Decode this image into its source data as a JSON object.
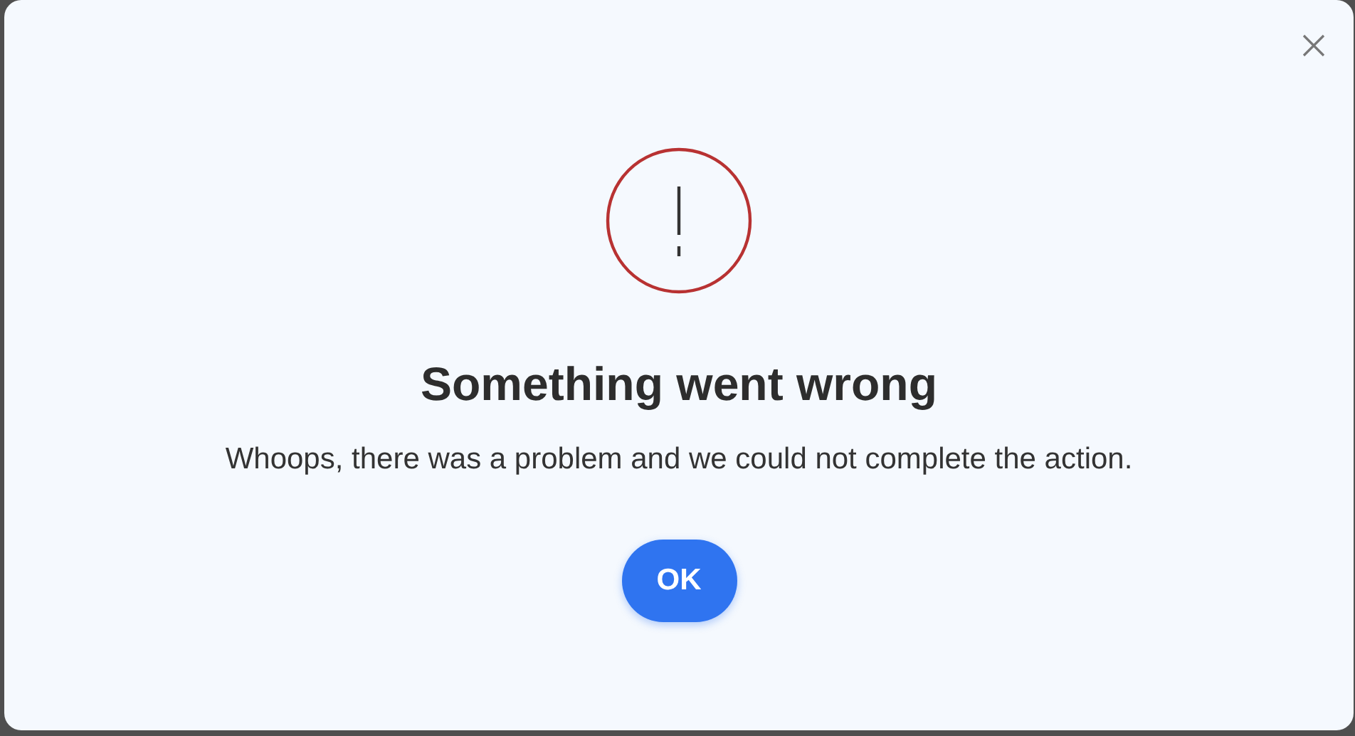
{
  "dialog": {
    "title": "Something went wrong",
    "message": "Whoops, there was a problem and we could not complete the action.",
    "buttons": [
      {
        "label": "OK",
        "kind": "primary"
      }
    ]
  }
}
